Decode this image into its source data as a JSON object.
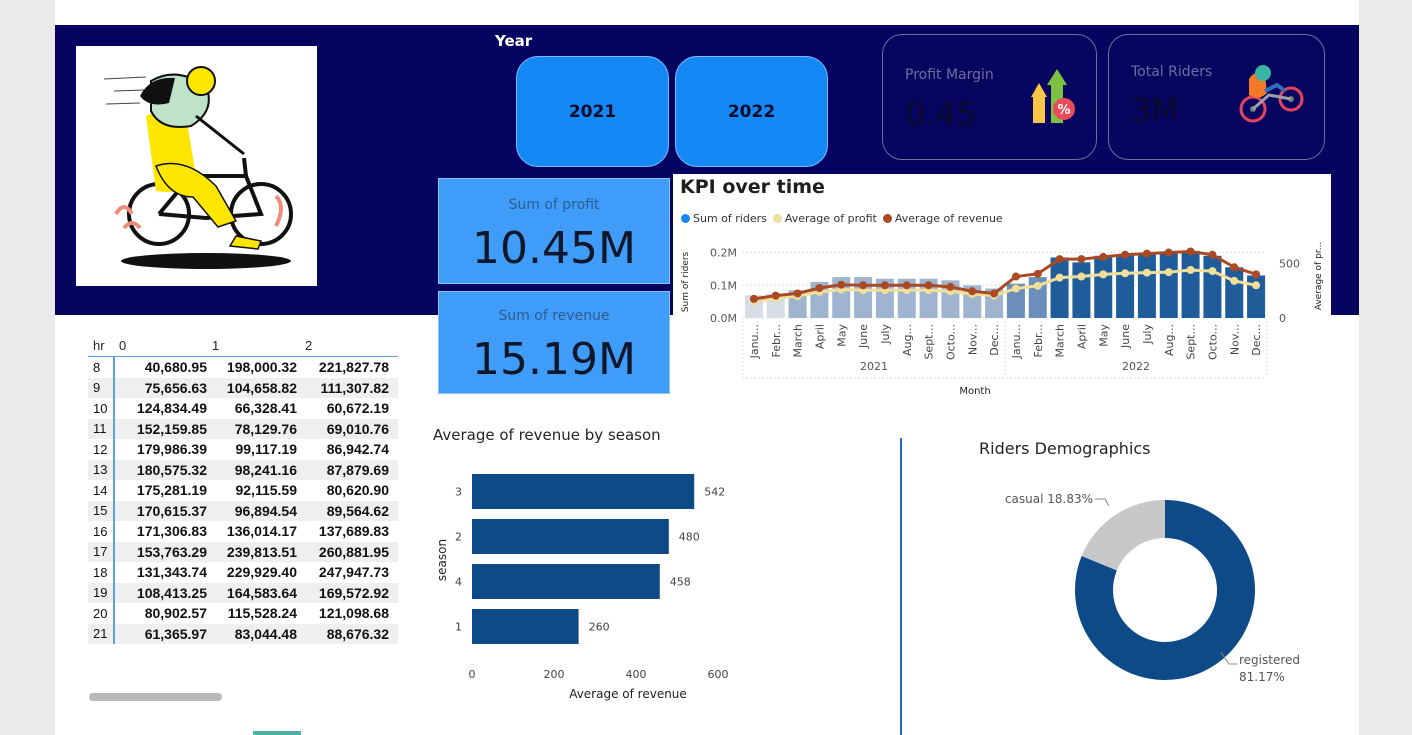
{
  "year_slicer": {
    "title": "Year",
    "options": [
      "2021",
      "2022"
    ]
  },
  "kpis": {
    "profit_margin": {
      "label": "Profit Margin",
      "value": "0.45"
    },
    "total_riders": {
      "label": "Total Riders",
      "value": "3M"
    },
    "sum_profit": {
      "label": "Sum of profit",
      "value": "10.45M"
    },
    "sum_revenue": {
      "label": "Sum of revenue",
      "value": "15.19M"
    }
  },
  "colors": {
    "banner": "#050561",
    "accent_blue": "#1488f5",
    "navy_bar": "#0d4a87",
    "riders_bar": "#1f5c9a",
    "profit_line": "#efdf9a",
    "revenue_line": "#a94a25",
    "donut_gray": "#c8c8c8"
  },
  "hr_table": {
    "columns": [
      "hr",
      "0",
      "1",
      "2"
    ],
    "rows": [
      [
        "8",
        "40,680.95",
        "198,000.32",
        "221,827.78"
      ],
      [
        "9",
        "75,656.63",
        "104,658.82",
        "111,307.82"
      ],
      [
        "10",
        "124,834.49",
        "66,328.41",
        "60,672.19"
      ],
      [
        "11",
        "152,159.85",
        "78,129.76",
        "69,010.76"
      ],
      [
        "12",
        "179,986.39",
        "99,117.19",
        "86,942.74"
      ],
      [
        "13",
        "180,575.32",
        "98,241.16",
        "87,879.69"
      ],
      [
        "14",
        "175,281.19",
        "92,115.59",
        "80,620.90"
      ],
      [
        "15",
        "170,615.37",
        "96,894.54",
        "89,564.62"
      ],
      [
        "16",
        "171,306.83",
        "136,014.17",
        "137,689.83"
      ],
      [
        "17",
        "153,763.29",
        "239,813.51",
        "260,881.95"
      ],
      [
        "18",
        "131,343.74",
        "229,929.40",
        "247,947.73"
      ],
      [
        "19",
        "108,413.25",
        "164,583.64",
        "169,572.92"
      ],
      [
        "20",
        "80,902.57",
        "115,528.24",
        "121,098.68"
      ],
      [
        "21",
        "61,365.97",
        "83,044.48",
        "88,676.32"
      ]
    ]
  },
  "chart_data": [
    {
      "type": "bar",
      "title": "KPI over time",
      "xlabel": "Month",
      "ylabel": "Sum of riders",
      "y2label": "Average of pr...",
      "legend": [
        "Sum of riders",
        "Average of profit",
        "Average of revenue"
      ],
      "legend_position": "top-left",
      "categories": [
        "Janu...",
        "Febr...",
        "March",
        "April",
        "May",
        "June",
        "July",
        "Aug...",
        "Sept...",
        "Octo...",
        "Nov...",
        "Dec...",
        "Janu...",
        "Febr...",
        "March",
        "April",
        "May",
        "June",
        "July",
        "Aug...",
        "Sept...",
        "Octo...",
        "Nov...",
        "Dec..."
      ],
      "groups": [
        "2021",
        "2022"
      ],
      "y_ticks": [
        "0.0M",
        "0.1M",
        "0.2M"
      ],
      "y2_ticks": [
        "0",
        "500"
      ],
      "ylim": [
        0,
        0.22
      ],
      "y2lim": [
        0,
        660
      ],
      "series": [
        {
          "name": "Sum of riders",
          "kind": "bar",
          "values": [
            0.07,
            0.075,
            0.085,
            0.11,
            0.125,
            0.125,
            0.12,
            0.12,
            0.12,
            0.115,
            0.1,
            0.09,
            0.105,
            0.125,
            0.185,
            0.17,
            0.19,
            0.195,
            0.2,
            0.2,
            0.205,
            0.19,
            0.155,
            0.13
          ]
        },
        {
          "name": "Average of profit",
          "kind": "line",
          "values": [
            150,
            180,
            200,
            240,
            260,
            255,
            255,
            255,
            255,
            245,
            220,
            205,
            270,
            295,
            370,
            380,
            400,
            410,
            415,
            420,
            440,
            430,
            340,
            300
          ]
        },
        {
          "name": "Average of revenue",
          "kind": "line",
          "values": [
            175,
            205,
            225,
            275,
            305,
            300,
            300,
            300,
            300,
            285,
            245,
            225,
            380,
            405,
            540,
            540,
            560,
            580,
            590,
            600,
            610,
            580,
            465,
            400
          ]
        }
      ]
    },
    {
      "type": "bar",
      "orientation": "horizontal",
      "title": "Average of revenue by season",
      "xlabel": "Average of revenue",
      "ylabel": "season",
      "categories": [
        "3",
        "2",
        "4",
        "1"
      ],
      "values": [
        542,
        480,
        458,
        260
      ],
      "xlim": [
        0,
        600
      ],
      "x_ticks": [
        "0",
        "200",
        "400",
        "600"
      ]
    },
    {
      "type": "pie",
      "donut": true,
      "title": "Riders Demographics",
      "categories": [
        "registered",
        "casual"
      ],
      "values": [
        81.17,
        18.83
      ],
      "labels": [
        "registered",
        "casual 18.83%"
      ],
      "value_labels": [
        "81.17%",
        ""
      ]
    }
  ]
}
